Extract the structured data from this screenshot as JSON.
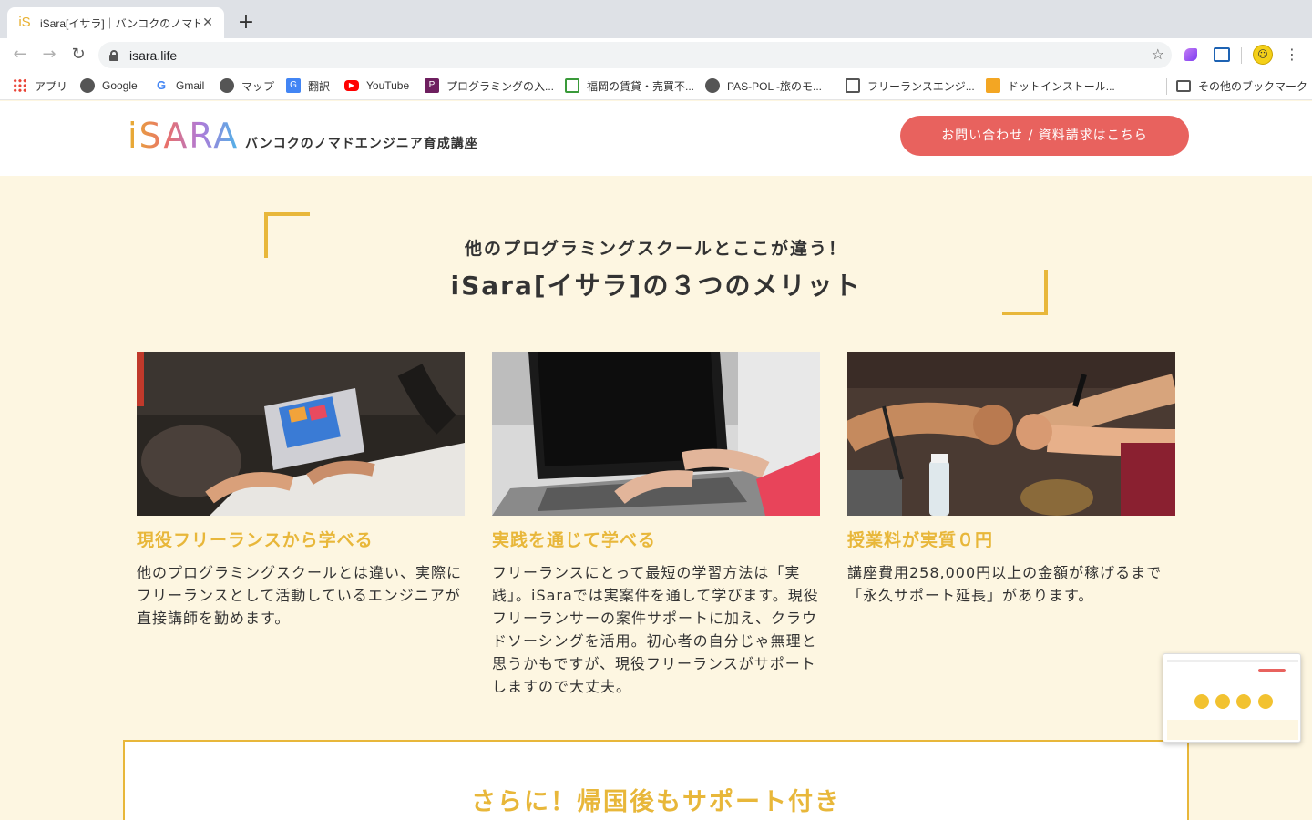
{
  "browser": {
    "tab_title": "iSara[イサラ]｜バンコクのノマドエ",
    "url": "isara.life",
    "bookmarks": [
      {
        "label": "アプリ",
        "icon": "apps-grid-icon"
      },
      {
        "label": "Google",
        "icon": "globe-icon"
      },
      {
        "label": "Gmail",
        "icon": "google-g-icon"
      },
      {
        "label": "マップ",
        "icon": "globe-icon"
      },
      {
        "label": "翻訳",
        "icon": "translate-icon"
      },
      {
        "label": "YouTube",
        "icon": "youtube-icon"
      },
      {
        "label": "プログラミングの入...",
        "icon": "progate-icon"
      },
      {
        "label": "福岡の賃貸・売買不...",
        "icon": "house-icon"
      },
      {
        "label": "PAS-POL -旅のモ...",
        "icon": "globe-icon"
      },
      {
        "label": "フリーランスエンジ...",
        "icon": "home-outline-icon"
      },
      {
        "label": "ドットインストール...",
        "icon": "box-icon"
      },
      {
        "label": "その他のブックマーク",
        "icon": "folder-icon"
      }
    ]
  },
  "header": {
    "logo": "iSARA",
    "tagline": "バンコクのノマドエンジニア育成講座",
    "cta_label": "お問い合わせ / 資料請求はこちら"
  },
  "merits": {
    "subtitle": "他のプログラミングスクールとここが違う！",
    "title": "iSara[イサラ]の３つのメリット",
    "cards": [
      {
        "title": "現役フリーランスから学べる",
        "text": "他のプログラミングスクールとは違い、実際にフリーランスとして活動しているエンジニアが直接講師を勤めます。"
      },
      {
        "title": "実践を通じて学べる",
        "text": "フリーランスにとって最短の学習方法は「実践」。iSaraでは実案件を通して学びます。現役フリーランサーの案件サポートに加え、クラウドソーシングを活用。初心者の自分じゃ無理と思うかもですが、現役フリーランスがサポートしますので大丈夫。"
      },
      {
        "title": "授業料が実質０円",
        "text": "講座費用258,000円以上の金額が稼げるまで「永久サポート延長」があります。"
      }
    ]
  },
  "support": {
    "title": "さらに！帰国後もサポート付き"
  },
  "colors": {
    "accent": "#e8b73a",
    "cta": "#e8625e",
    "background": "#fdf6e1"
  }
}
